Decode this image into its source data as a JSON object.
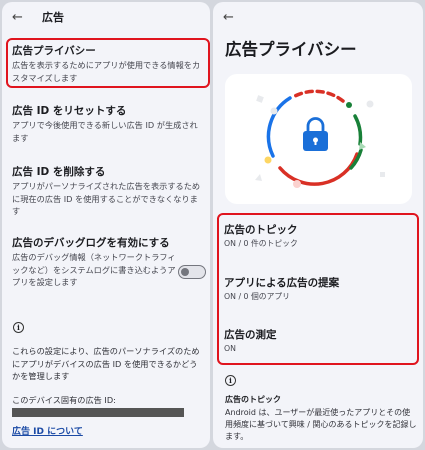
{
  "left": {
    "title": "広告",
    "items": [
      {
        "title": "広告プライバシー",
        "subtitle": "広告を表示するためにアプリが使用できる情報をカスタマイズします"
      },
      {
        "title": "広告 ID をリセットする",
        "subtitle": "アプリで今後使用できる新しい広告 ID が生成されます"
      },
      {
        "title": "広告 ID を削除する",
        "subtitle": "アプリがパーソナライズされた広告を表示するために現在の広告 ID を使用することができなくなります"
      },
      {
        "title": "広告のデバッグログを有効にする",
        "subtitle": "広告のデバッグ情報（ネットワークトラフィックなど）をシステムログに書き込むようアプリを設定します"
      }
    ],
    "debug_toggle": "off",
    "info_text": "これらの設定により、広告のパーソナライズのためにアプリがデバイスの広告 ID を使用できるかどうかを管理します",
    "device_id_label": "このデバイス固有の広告 ID:",
    "about_link": "広告 ID について"
  },
  "right": {
    "title": "広告プライバシー",
    "items": [
      {
        "title": "広告のトピック",
        "subtitle": "ON / 0 件のトピック"
      },
      {
        "title": "アプリによる広告の提案",
        "subtitle": "ON / 0 個のアプリ"
      },
      {
        "title": "広告の測定",
        "subtitle": "ON"
      }
    ],
    "footer_title": "広告のトピック",
    "footer_body": "Android は、ユーザーが最近使ったアプリとその使用頻度に基づいて興味 / 関心のあるトピックを記録します。"
  },
  "colors": {
    "highlight": "#e0141e",
    "lock": "#1a6fd8",
    "ring_blue": "#1a73e8",
    "ring_red": "#d93025",
    "ring_green": "#188038",
    "link": "#1b4aa5"
  },
  "icons": [
    "back-arrow-icon",
    "info-icon",
    "lock-icon"
  ]
}
